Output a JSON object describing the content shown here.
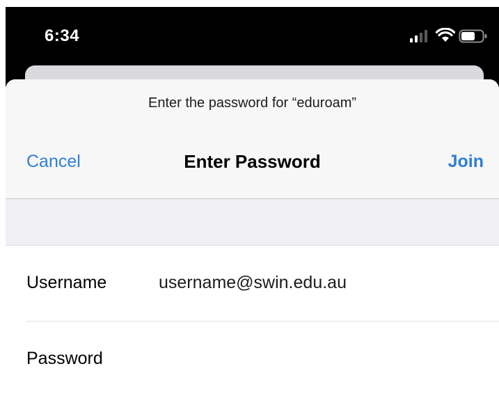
{
  "status_bar": {
    "time": "6:34",
    "icons": [
      "cellular-signal-icon",
      "wifi-icon",
      "battery-icon"
    ]
  },
  "sheet": {
    "prompt": "Enter the password for “eduroam”",
    "nav": {
      "cancel_label": "Cancel",
      "title": "Enter Password",
      "join_label": "Join"
    },
    "form": {
      "username": {
        "label": "Username",
        "value": "username@swin.edu.au"
      },
      "password": {
        "label": "Password",
        "value": ""
      }
    }
  },
  "colors": {
    "accent": "#2f7fd6",
    "status_bar_bg": "#000000",
    "nav_bg": "#f7f7f7",
    "grouped_bg": "#efeff4",
    "cell_bg": "#ffffff"
  }
}
